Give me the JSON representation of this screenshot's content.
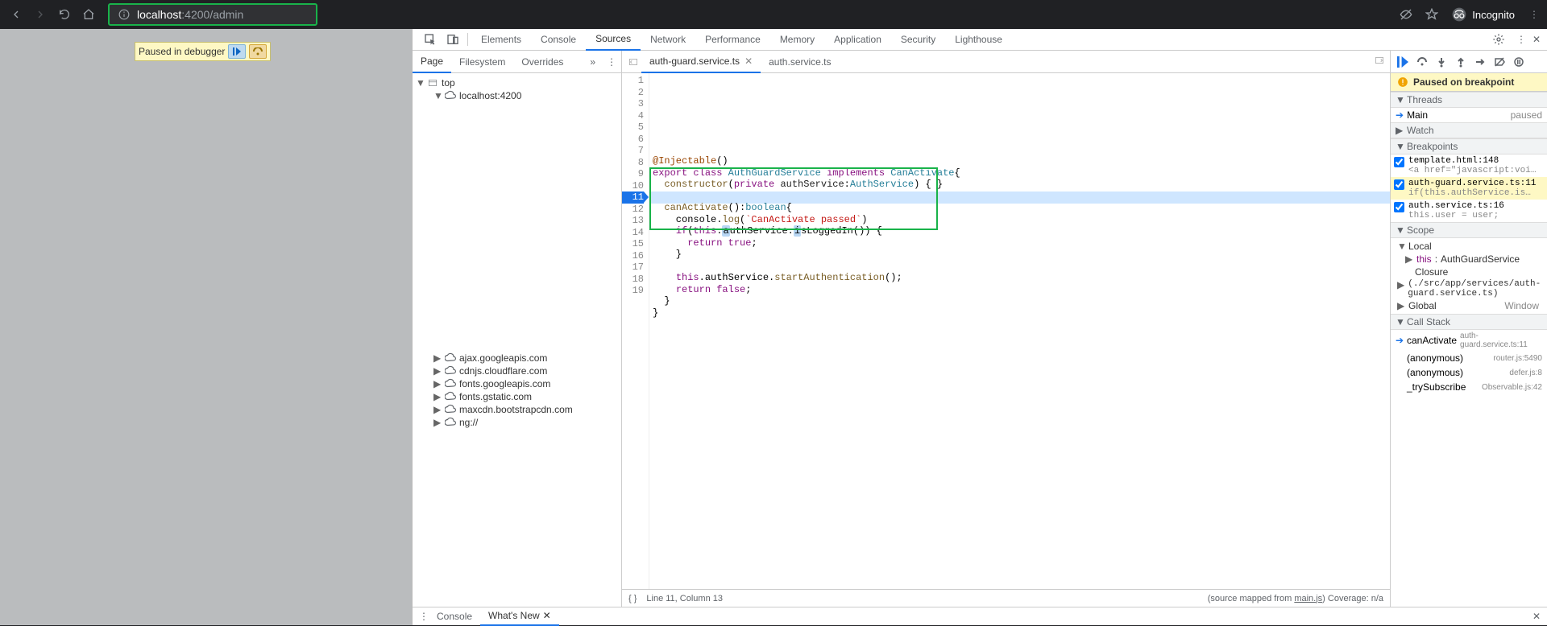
{
  "browser": {
    "url_host": "localhost",
    "url_port": ":4200",
    "url_path": "/admin",
    "incognito": "Incognito"
  },
  "paused_overlay": "Paused in debugger",
  "devtools_tabs": [
    "Elements",
    "Console",
    "Sources",
    "Network",
    "Performance",
    "Memory",
    "Application",
    "Security",
    "Lighthouse"
  ],
  "devtools_active": "Sources",
  "left_subtabs": [
    "Page",
    "Filesystem",
    "Overrides"
  ],
  "left_subtab_active": "Page",
  "navigator": {
    "top": "top",
    "host": "localhost:4200",
    "bottom": [
      "ajax.googleapis.com",
      "cdnjs.cloudflare.com",
      "fonts.googleapis.com",
      "fonts.gstatic.com",
      "maxcdn.bootstrapcdn.com",
      "ng://"
    ]
  },
  "file_tabs": [
    {
      "name": "auth-guard.service.ts",
      "active": true,
      "closable": true
    },
    {
      "name": "auth.service.ts",
      "active": false,
      "closable": false
    }
  ],
  "code": {
    "lines": [
      {
        "n": 1,
        "html": ""
      },
      {
        "n": 2,
        "html": ""
      },
      {
        "n": 3,
        "html": ""
      },
      {
        "n": 4,
        "html": ""
      },
      {
        "n": 5,
        "html": "<span class='prop'>@Injectable</span>()"
      },
      {
        "n": 6,
        "html": "<span class='kw'>export</span> <span class='kw'>class</span> <span class='typ'>AuthGuardService</span> <span class='kw'>implements</span> <span class='typ'>CanActivate</span>{"
      },
      {
        "n": 7,
        "html": "  <span class='fn'>constructor</span>(<span class='kw'>private</span> <span class='id'>authService</span>:<span class='typ'>AuthService</span>) { }"
      },
      {
        "n": 8,
        "html": ""
      },
      {
        "n": 9,
        "html": "  <span class='fn'>canActivate</span>():<span class='typ'>boolean</span>{"
      },
      {
        "n": 10,
        "html": "    console.<span class='fn'>log</span>(<span class='str'>`CanActivate passed`</span>)"
      },
      {
        "n": 11,
        "html": "    <span class='kw'>if</span>(<span class='kw'>this</span>.<span class='eval-pill'>a</span>uthService.<span class='eval-pill'>i</span>sLoggedIn()) {",
        "bp": true,
        "hl": true
      },
      {
        "n": 12,
        "html": "      <span class='kw'>return</span> <span class='kw'>true</span>;"
      },
      {
        "n": 13,
        "html": "    }"
      },
      {
        "n": 14,
        "html": ""
      },
      {
        "n": 15,
        "html": "    <span class='kw'>this</span>.authService.<span class='fn'>startAuthentication</span>();"
      },
      {
        "n": 16,
        "html": "    <span class='kw'>return</span> <span class='kw'>false</span>;"
      },
      {
        "n": 17,
        "html": "  }"
      },
      {
        "n": 18,
        "html": "}"
      },
      {
        "n": 19,
        "html": ""
      }
    ]
  },
  "status": {
    "cursor": "Line 11, Column 13",
    "mapping": "(source mapped from ",
    "mapfile": "main.js",
    "mapping2": ")  Coverage: n/a"
  },
  "paused_banner": "Paused on breakpoint",
  "sections": {
    "threads": "Threads",
    "watch": "Watch",
    "breakpoints": "Breakpoints",
    "scope": "Scope",
    "callstack": "Call Stack"
  },
  "threads": [
    {
      "name": "Main",
      "state": "paused",
      "active": true
    }
  ],
  "breakpoints": [
    {
      "file": "template.html:148",
      "snippet": "<a href=\"javascript:voi…",
      "active": false
    },
    {
      "file": "auth-guard.service.ts:11",
      "snippet": "if(this.authService.is…",
      "active": true
    },
    {
      "file": "auth.service.ts:16",
      "snippet": "this.user = user;",
      "active": false
    }
  ],
  "scope": {
    "local_hdr": "Local",
    "this": "this",
    "this_t": "AuthGuardService",
    "closure": "Closure",
    "closure_path": "(./src/app/services/auth-guard.service.ts)",
    "global": "Global",
    "global_v": "Window"
  },
  "callstack": [
    {
      "name": "canActivate",
      "loc": "auth-guard.service.ts:11",
      "active": true
    },
    {
      "name": "(anonymous)",
      "loc": "router.js:5490"
    },
    {
      "name": "(anonymous)",
      "loc": "defer.js:8"
    },
    {
      "name": "_trySubscribe",
      "loc": "Observable.js:42"
    }
  ],
  "drawer": {
    "tabs": [
      "Console",
      "What's New"
    ],
    "active": "What's New"
  }
}
